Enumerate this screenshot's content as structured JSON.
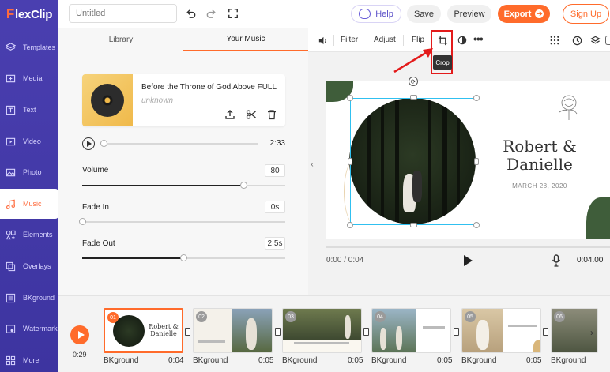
{
  "app": {
    "logo_prefix": "F",
    "logo_rest": "lexClip",
    "project_title_placeholder": "Untitled"
  },
  "header": {
    "help_label": "Help",
    "save_label": "Save",
    "preview_label": "Preview",
    "export_label": "Export",
    "signup_label": "Sign Up",
    "accent_color": "#ff6b2b"
  },
  "sidebar": {
    "items": [
      {
        "label": "Templates",
        "icon": "layers-icon"
      },
      {
        "label": "Media",
        "icon": "media-icon"
      },
      {
        "label": "Text",
        "icon": "text-icon"
      },
      {
        "label": "Video",
        "icon": "video-icon"
      },
      {
        "label": "Photo",
        "icon": "photo-icon"
      },
      {
        "label": "Music",
        "icon": "music-icon",
        "active": true
      },
      {
        "label": "Elements",
        "icon": "elements-icon"
      },
      {
        "label": "Overlays",
        "icon": "overlays-icon"
      },
      {
        "label": "BKground",
        "icon": "background-icon"
      },
      {
        "label": "Watermark",
        "icon": "watermark-icon"
      },
      {
        "label": "More",
        "icon": "more-icon"
      }
    ]
  },
  "panel": {
    "tabs": [
      "Library",
      "Your Music"
    ],
    "active_tab": "Your Music",
    "track": {
      "title": "Before the Throne of God Above FULL",
      "artist": "unknown",
      "duration": "2:33",
      "progress": 0
    },
    "volume": {
      "label": "Volume",
      "value": "80",
      "level": 0.8
    },
    "fade_in": {
      "label": "Fade In",
      "value": "0s",
      "level": 0
    },
    "fade_out": {
      "label": "Fade Out",
      "value": "2.5s",
      "level": 0.5
    }
  },
  "canvas_toolbar": {
    "filter_label": "Filter",
    "adjust_label": "Adjust",
    "flip_label": "Flip",
    "crop_tooltip": "Crop"
  },
  "slide": {
    "names_line1": "Robert &",
    "names_line2": "Danielle",
    "date": "MARCH 28, 2020"
  },
  "player": {
    "current_time": "0:00 / 0:04",
    "end_time": "0:04.00"
  },
  "timeline": {
    "play_time": "0:29",
    "clips": [
      {
        "num": "01",
        "label": "BKground",
        "dur": "0:04",
        "active": true
      },
      {
        "num": "02",
        "label": "BKground",
        "dur": "0:05"
      },
      {
        "num": "03",
        "label": "BKground",
        "dur": "0:05"
      },
      {
        "num": "04",
        "label": "BKground",
        "dur": "0:05"
      },
      {
        "num": "05",
        "label": "BKground",
        "dur": "0:05"
      },
      {
        "num": "06",
        "label": "BKground",
        "dur": ""
      }
    ],
    "clip_captions": {
      "clip01_line1": "Robert &",
      "clip01_line2": "Danielle"
    }
  }
}
